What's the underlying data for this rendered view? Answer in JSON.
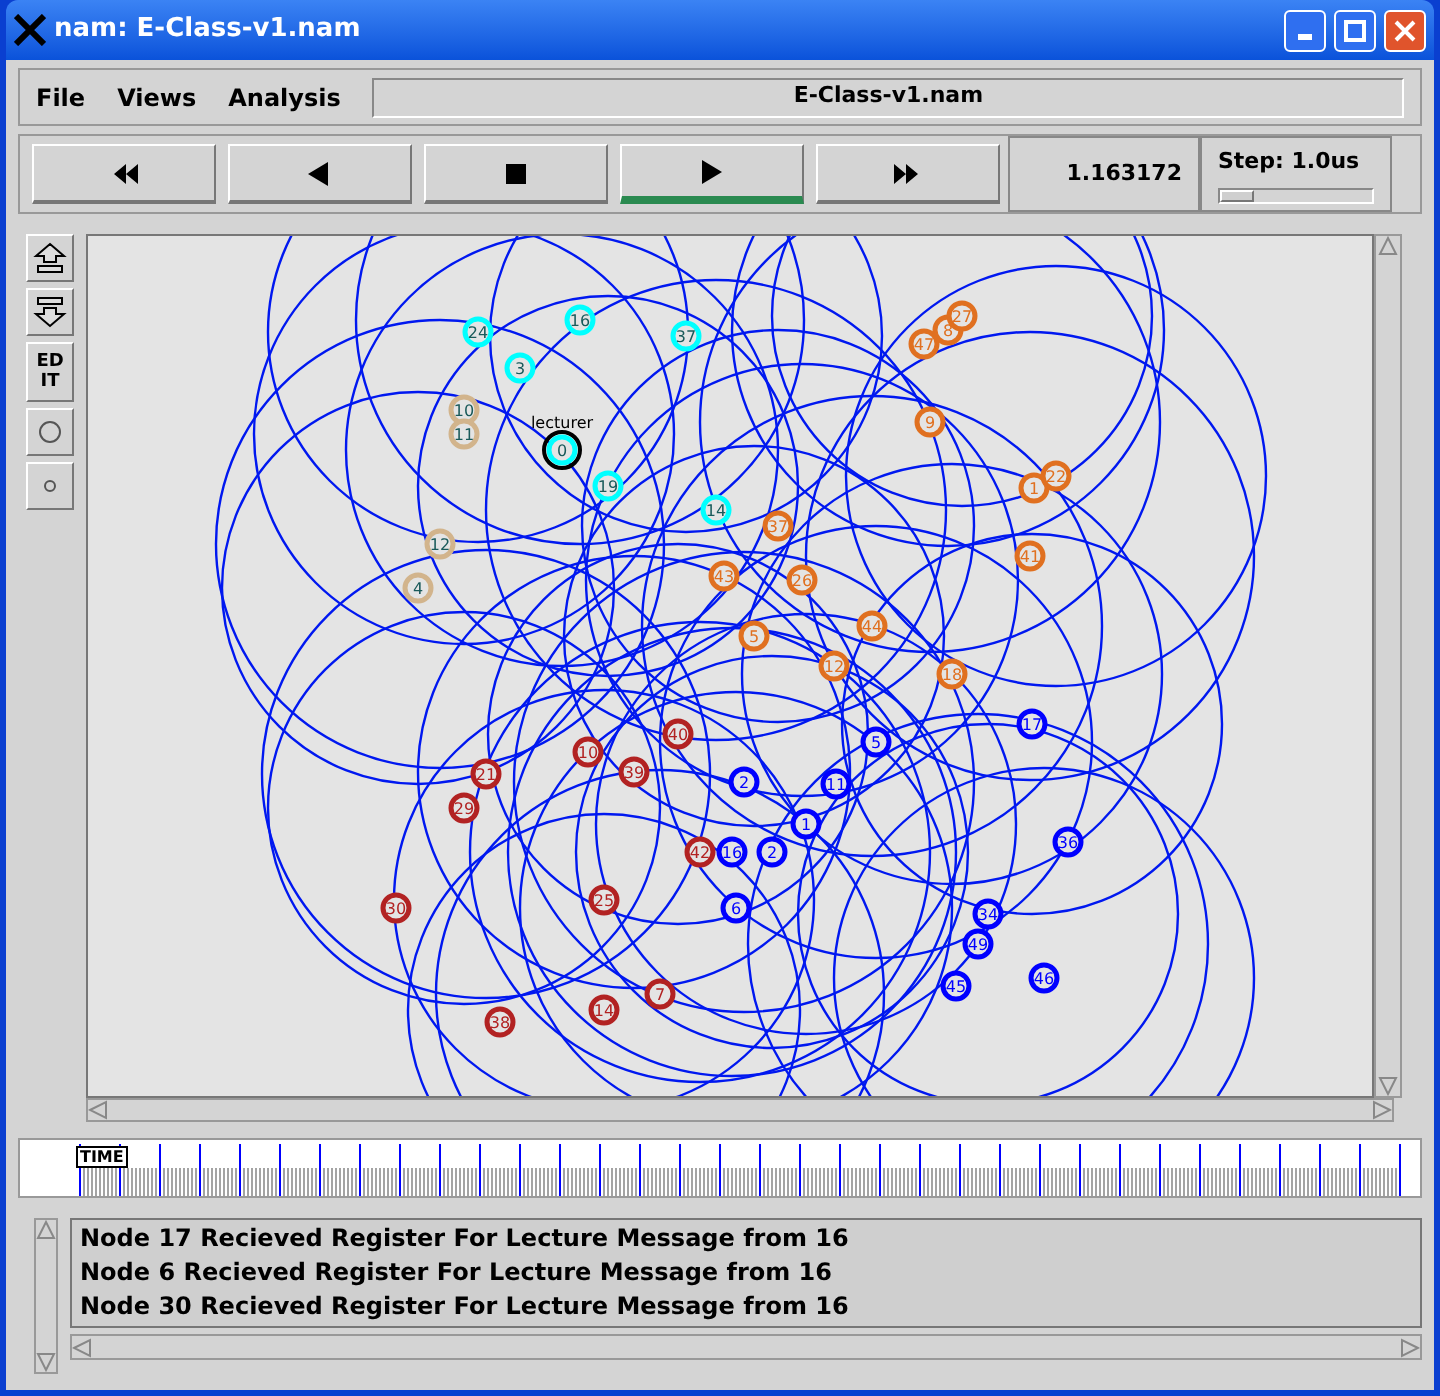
{
  "window": {
    "title": "nam: E-Class-v1.nam"
  },
  "menu": [
    "File",
    "Views",
    "Analysis"
  ],
  "file_name": "E-Class-v1.nam",
  "playback": [
    {
      "kind": "rewind",
      "selected": false
    },
    {
      "kind": "back",
      "selected": false
    },
    {
      "kind": "stop",
      "selected": false
    },
    {
      "kind": "play",
      "selected": true
    },
    {
      "kind": "forward",
      "selected": false
    }
  ],
  "time": "1.163172",
  "step": {
    "label": "Step: 1.0us",
    "level": 0.22
  },
  "tools": [
    {
      "kind": "zoom-in"
    },
    {
      "kind": "zoom-out"
    },
    {
      "kind": "edit",
      "label": "EDIT"
    },
    {
      "kind": "big-dot"
    },
    {
      "kind": "small-dot"
    }
  ],
  "nodes": [
    {
      "label": "24",
      "color": "#00ffff",
      "selected": false
    },
    {
      "label": "16",
      "color": "#00ffff",
      "selected": false
    },
    {
      "label": "37",
      "color": "#00ffff",
      "selected": false
    },
    {
      "label": "3",
      "color": "#00ffff",
      "selected": false
    },
    {
      "label": "0",
      "color": "#00ffff",
      "selected": true,
      "tag": "lecturer"
    },
    {
      "label": "19",
      "color": "#00ffff",
      "selected": false
    },
    {
      "label": "14",
      "color": "#00ffff",
      "selected": false
    },
    {
      "label": "10",
      "color": "#d2b48c",
      "selected": false
    },
    {
      "label": "11",
      "color": "#d2b48c",
      "selected": false
    },
    {
      "label": "12",
      "color": "#d2b48c",
      "selected": false
    },
    {
      "label": "4",
      "color": "#d2b48c",
      "selected": false
    },
    {
      "label": "47",
      "color": "#e07020",
      "selected": false
    },
    {
      "label": "8",
      "color": "#e07020",
      "selected": false
    },
    {
      "label": "27",
      "color": "#e07020",
      "selected": false
    },
    {
      "label": "9",
      "color": "#e07020",
      "selected": false
    },
    {
      "label": "1",
      "color": "#e07020",
      "selected": false
    },
    {
      "label": "22",
      "color": "#e07020",
      "selected": false
    },
    {
      "label": "41",
      "color": "#e07020",
      "selected": false
    },
    {
      "label": "37",
      "color": "#e07020",
      "selected": false
    },
    {
      "label": "43",
      "color": "#e07020",
      "selected": false
    },
    {
      "label": "26",
      "color": "#e07020",
      "selected": false
    },
    {
      "label": "5",
      "color": "#e07020",
      "selected": false
    },
    {
      "label": "44",
      "color": "#e07020",
      "selected": false
    },
    {
      "label": "12",
      "color": "#e07020",
      "selected": false
    },
    {
      "label": "18",
      "color": "#e07020",
      "selected": false
    },
    {
      "label": "21",
      "color": "#b22222",
      "selected": false
    },
    {
      "label": "29",
      "color": "#b22222",
      "selected": false
    },
    {
      "label": "10",
      "color": "#b22222",
      "selected": false
    },
    {
      "label": "39",
      "color": "#b22222",
      "selected": false
    },
    {
      "label": "40",
      "color": "#b22222",
      "selected": false
    },
    {
      "label": "42",
      "color": "#b22222",
      "selected": false
    },
    {
      "label": "30",
      "color": "#b22222",
      "selected": false
    },
    {
      "label": "25",
      "color": "#b22222",
      "selected": false
    },
    {
      "label": "7",
      "color": "#b22222",
      "selected": false
    },
    {
      "label": "14",
      "color": "#b22222",
      "selected": false
    },
    {
      "label": "38",
      "color": "#b22222",
      "selected": false
    },
    {
      "label": "5",
      "color": "#0000ff",
      "selected": false
    },
    {
      "label": "17",
      "color": "#0000ff",
      "selected": false
    },
    {
      "label": "2",
      "color": "#0000ff",
      "selected": false
    },
    {
      "label": "11",
      "color": "#0000ff",
      "selected": false
    },
    {
      "label": "1",
      "color": "#0000ff",
      "selected": false
    },
    {
      "label": "16",
      "color": "#0000ff",
      "selected": false
    },
    {
      "label": "2",
      "color": "#0000ff",
      "selected": false
    },
    {
      "label": "36",
      "color": "#0000ff",
      "selected": false
    },
    {
      "label": "6",
      "color": "#0000ff",
      "selected": false
    },
    {
      "label": "34",
      "color": "#0000ff",
      "selected": false
    },
    {
      "label": "49",
      "color": "#0000ff",
      "selected": false
    },
    {
      "label": "45",
      "color": "#0000ff",
      "selected": false
    },
    {
      "label": "46",
      "color": "#0000ff",
      "selected": false
    }
  ],
  "timeline": {
    "marker": "TIME"
  },
  "log": [
    "Node 17 Recieved Register For Lecture Message from 16",
    "Node 6 Recieved Register For Lecture Message from 16",
    "Node 30 Recieved Register For Lecture Message from 16"
  ]
}
